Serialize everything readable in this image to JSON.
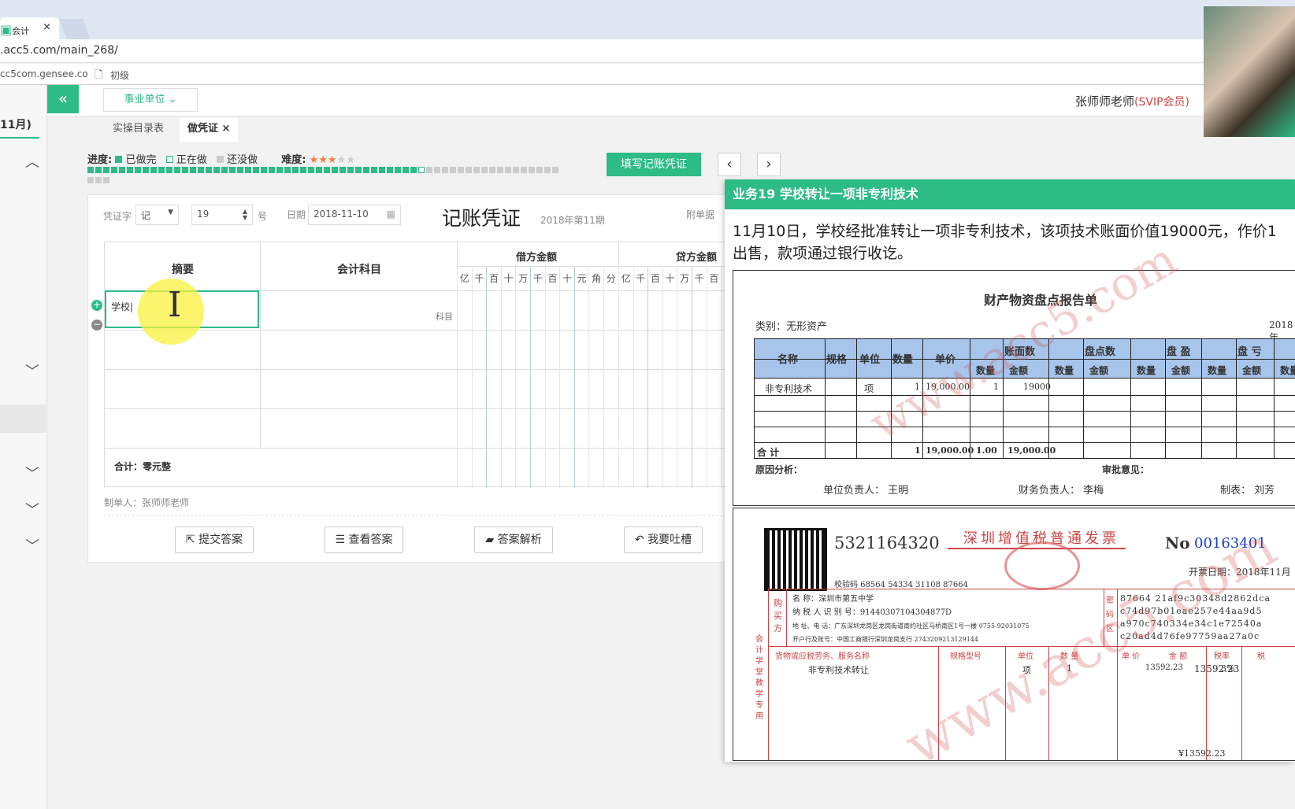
{
  "browser": {
    "tab_title": "会计",
    "url": ".acc5.com/main_268/",
    "bookmarks": [
      "cc5com.gensee.co",
      "初级"
    ]
  },
  "header": {
    "dept": "事业单位",
    "user": "张师师老师",
    "member": "(SVIP会员)"
  },
  "sidebar": {
    "month": "11月)"
  },
  "tabs": [
    "实操目录表",
    "做凭证"
  ],
  "progress": {
    "label": "进度:",
    "done": "已做完",
    "doing": "正在做",
    "todo": "还没做",
    "diff_label": "难度:",
    "done_count": 42,
    "total": 63
  },
  "actions": {
    "fill": "填写记账凭证",
    "prev": "‹",
    "next": "›"
  },
  "voucher": {
    "word_label": "凭证字",
    "word": "记",
    "num": "19",
    "num_unit": "号",
    "date_label": "日期",
    "date": "2018-11-10",
    "title": "记账凭证",
    "period": "2018年第11期",
    "attach": "附单据",
    "col_summary": "摘要",
    "col_subject": "会计科目",
    "col_debit": "借方金额",
    "col_credit": "贷方金额",
    "digits": [
      "亿",
      "千",
      "百",
      "十",
      "万",
      "千",
      "百",
      "十",
      "元",
      "角",
      "分"
    ],
    "row1_summary": "学校",
    "row1_subject_hint": "科目",
    "total": "合计：零元整",
    "maker": "制单人：张师师老师"
  },
  "buttons": [
    "提交答案",
    "查看答案",
    "答案解析",
    "我要吐槽"
  ],
  "panel": {
    "title": "业务19 学校转让一项非专利技术",
    "desc_line1": "11月10日，学校经批准转让一项非专利技术，该项技术账面价值19000元，作价1",
    "desc_line2": "出售，款项通过银行收讫。"
  },
  "report": {
    "title": "财产物资盘点报告单",
    "category": "类别：无形资产",
    "year": "2018年",
    "h_name": "名称",
    "h_spec": "规格",
    "h_unit": "单位",
    "h_qty": "数量",
    "h_price": "单价",
    "h_book": "账面数",
    "h_count": "盘点数",
    "h_gain": "盘 盈",
    "h_loss": "盘 亏",
    "sub_qty": "数量",
    "sub_amt": "金额",
    "r_name": "非专利技术",
    "r_unit": "项",
    "r_qty": "1",
    "r_price": "19,000.00",
    "r_bqty": "1",
    "r_bamt": "19000",
    "t_label": "合   计",
    "t_qty": "1",
    "t_price": "19,000.00",
    "t_bqty": "1.00",
    "t_bamt": "19,000.00",
    "reason": "原因分析：",
    "approve": "审批意见：",
    "sign1": "单位负责人：  王明",
    "sign2": "财务负责人：  李梅",
    "sign3": "制表：  刘芳"
  },
  "invoice": {
    "code": "5321164320",
    "title": "深圳增值税普通发票",
    "no_label": "No",
    "no": "00163401",
    "date": "开票日期：2018年11月",
    "check": "校验码 68564 54334 31108 87664",
    "buyer_name": "名        称：深圳市第五中学",
    "buyer_tax": "纳 税 人 识 别 号：914403071043048​77D",
    "buyer_addr": "地  址、电  话：广东深圳龙岗区龙岗街道南约社区马桥南区1号一楼 0755-92031075",
    "buyer_bank": "开户行及账号：中国工商银行深圳龙岗支行 2743209213129144",
    "cipher": [
      "87664 21af9c30348d2862dca",
      "c74d97b01eae257e44aa9d5",
      "a970c740334e34c1e72540a",
      "c20ad4d76fe97759aa27a0c"
    ],
    "h_goods": "货物或应税劳务、服务名称",
    "h_spec": "规格型号",
    "h_unit": "单位",
    "h_qty": "数  量",
    "h_price": "单 价",
    "h_amt": "金  额",
    "h_rate": "税率",
    "h_tax": "税",
    "item": "非专利技术转让",
    "item_unit": "项",
    "item_qty": "1",
    "item_price": "13592.23",
    "item_amt": "13592.23",
    "item_rate": "3%",
    "total_amt": "¥13592.23",
    "side": "会计学堂教学专用"
  },
  "watermark": "www.acc5.com",
  "colors": {
    "green": "#2dbb86",
    "red": "#c44"
  }
}
